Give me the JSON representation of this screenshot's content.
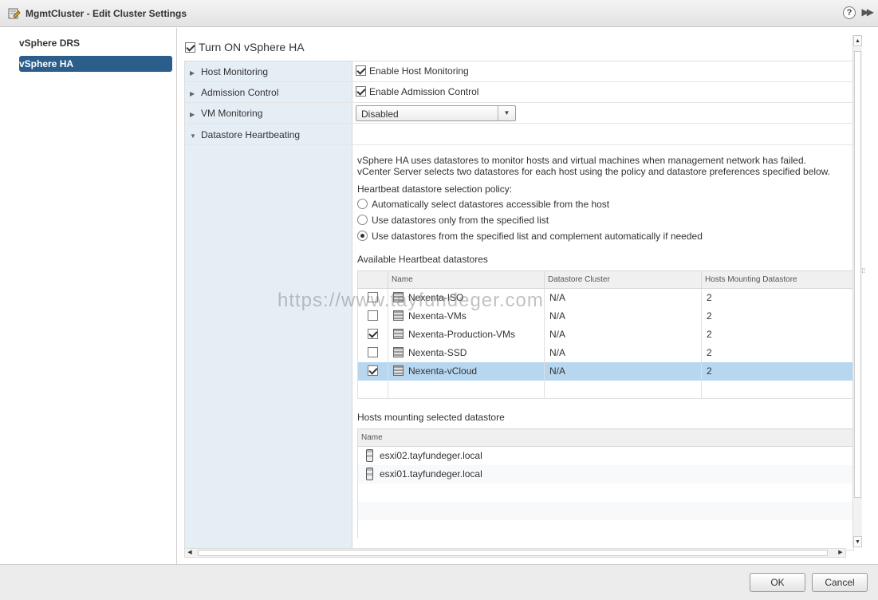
{
  "window": {
    "title": "MgmtCluster - Edit Cluster Settings",
    "help_glyph": "?",
    "expand_glyph": "▶▶"
  },
  "sidebar": {
    "items": [
      {
        "label": "vSphere DRS",
        "active": false
      },
      {
        "label": "vSphere HA",
        "active": true
      }
    ]
  },
  "main": {
    "turn_on_label": "Turn ON vSphere HA",
    "turn_on_checked": true,
    "rows": [
      {
        "label": "Host Monitoring",
        "value": "Enable Host Monitoring",
        "checked": true,
        "expanded": false
      },
      {
        "label": "Admission Control",
        "value": "Enable Admission Control",
        "checked": true,
        "expanded": false
      },
      {
        "label": "VM Monitoring",
        "value": "Disabled",
        "expanded": false
      },
      {
        "label": "Datastore Heartbeating",
        "expanded": true
      }
    ],
    "heartbeat": {
      "description_1": "vSphere HA uses datastores to monitor hosts and virtual machines when management network has failed.",
      "description_2": "vCenter Server selects two datastores for each host using the policy and datastore preferences specified below.",
      "policy_label": "Heartbeat datastore selection policy:",
      "policy_options": [
        "Automatically select datastores accessible from the host",
        "Use datastores only from the specified list",
        "Use datastores from the specified list and complement automatically if needed"
      ],
      "policy_selected": 2,
      "available_label": "Available Heartbeat datastores",
      "columns": [
        "Name",
        "Datastore Cluster",
        "Hosts Mounting Datastore"
      ],
      "datastores": [
        {
          "name": "Nexenta-ISO",
          "cluster": "N/A",
          "hosts": "2",
          "checked": false
        },
        {
          "name": "Nexenta-VMs",
          "cluster": "N/A",
          "hosts": "2",
          "checked": false
        },
        {
          "name": "Nexenta-Production-VMs",
          "cluster": "N/A",
          "hosts": "2",
          "checked": true
        },
        {
          "name": "Nexenta-SSD",
          "cluster": "N/A",
          "hosts": "2",
          "checked": false
        },
        {
          "name": "Nexenta-vCloud",
          "cluster": "N/A",
          "hosts": "2",
          "checked": true,
          "selected": true
        }
      ],
      "hosts_label": "Hosts mounting selected datastore",
      "hosts_column": "Name",
      "hosts": [
        "esxi02.tayfundeger.local",
        "esxi01.tayfundeger.local"
      ]
    }
  },
  "footer": {
    "ok_label": "OK",
    "cancel_label": "Cancel"
  },
  "watermark": "https://www.tayfundeger.com",
  "colors": {
    "accent": "#2c5e8c",
    "selected_row": "#b7d7f0",
    "label_column": "#e6eef5"
  }
}
